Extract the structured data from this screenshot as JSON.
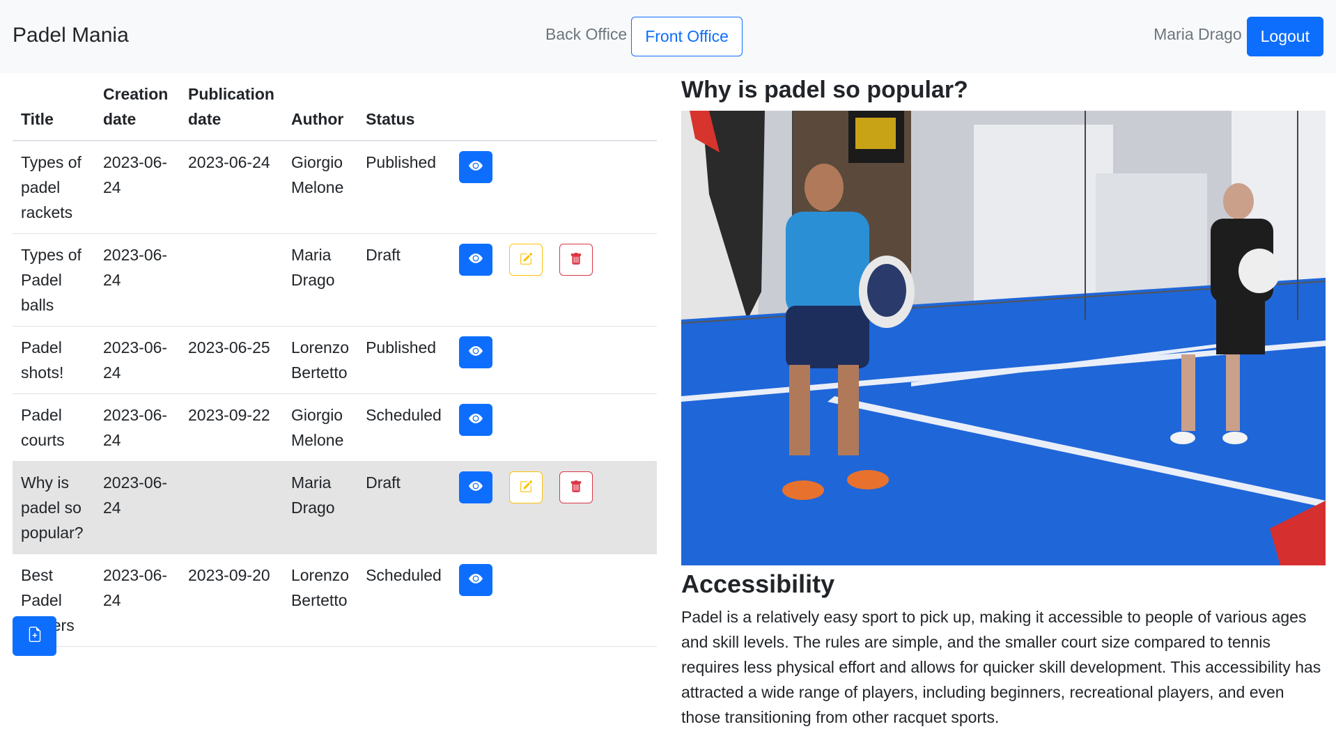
{
  "navbar": {
    "brand": "Padel Mania",
    "back_office": "Back Office",
    "front_office": "Front Office",
    "user_name": "Maria Drago",
    "logout": "Logout"
  },
  "table": {
    "headers": [
      "Title",
      "Creation date",
      "Publication date",
      "Author",
      "Status"
    ],
    "rows": [
      {
        "title": "Types of padel rackets",
        "created": "2023-06-24",
        "published": "2023-06-24",
        "author": "Giorgio Melone",
        "status": "Published",
        "editable": false
      },
      {
        "title": "Types of Padel balls",
        "created": "2023-06-24",
        "published": "",
        "author": "Maria Drago",
        "status": "Draft",
        "editable": true
      },
      {
        "title": "Padel shots!",
        "created": "2023-06-24",
        "published": "2023-06-25",
        "author": "Lorenzo Bertetto",
        "status": "Published",
        "editable": false
      },
      {
        "title": "Padel courts",
        "created": "2023-06-24",
        "published": "2023-09-22",
        "author": "Giorgio Melone",
        "status": "Scheduled",
        "editable": false
      },
      {
        "title": "Why is padel so popular?",
        "created": "2023-06-24",
        "published": "",
        "author": "Maria Drago",
        "status": "Draft",
        "editable": true,
        "selected": true
      },
      {
        "title": "Best Padel Players",
        "created": "2023-06-24",
        "published": "2023-09-20",
        "author": "Lorenzo Bertetto",
        "status": "Scheduled",
        "editable": false
      }
    ],
    "icons": {
      "view": "eye-icon",
      "edit": "pencil-square-icon",
      "delete": "trash-icon",
      "new": "file-plus-icon"
    }
  },
  "article": {
    "title": "Why is padel so popular?",
    "image_alt": "padel players on blue court",
    "section_heading": "Accessibility",
    "paragraph": "Padel is a relatively easy sport to pick up, making it accessible to people of various ages and skill levels. The rules are simple, and the smaller court size compared to tennis requires less physical effort and allows for quicker skill development. This accessibility has attracted a wide range of players, including beginners, recreational players, and even those transitioning from other racquet sports."
  },
  "colors": {
    "primary": "#0d6efd",
    "warning": "#ffc107",
    "danger": "#dc3545",
    "navbar_bg": "#f8f9fa",
    "selected_row": "#e4e4e4"
  }
}
